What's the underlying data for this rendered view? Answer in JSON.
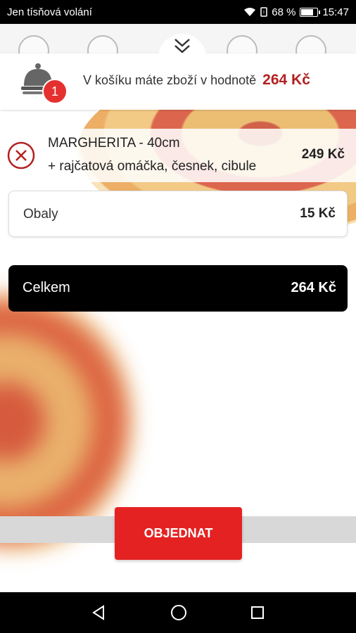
{
  "status_bar": {
    "carrier": "Jen tísňová volání",
    "battery_percent": "68 %",
    "battery_level": 0.68,
    "time": "15:47"
  },
  "cart": {
    "summary_text": "V košíku máte zboží v hodnotě",
    "summary_total": "264 Kč",
    "item_count": "1"
  },
  "items": [
    {
      "name": "MARGHERITA - 40cm",
      "extras": "+ rajčatová omáčka, česnek, cibule",
      "price": "249 Kč"
    }
  ],
  "packaging": {
    "label": "Obaly",
    "price": "15 Kč"
  },
  "total": {
    "label": "Celkem",
    "price": "264 Kč"
  },
  "order_button": {
    "label": "OBJEDNAT"
  },
  "colors": {
    "accent_red": "#e52222",
    "price_red": "#b32020"
  },
  "icons": {
    "cart": "cloche-icon",
    "remove": "remove-circle-icon",
    "collapse": "chevron-double-down-icon"
  }
}
